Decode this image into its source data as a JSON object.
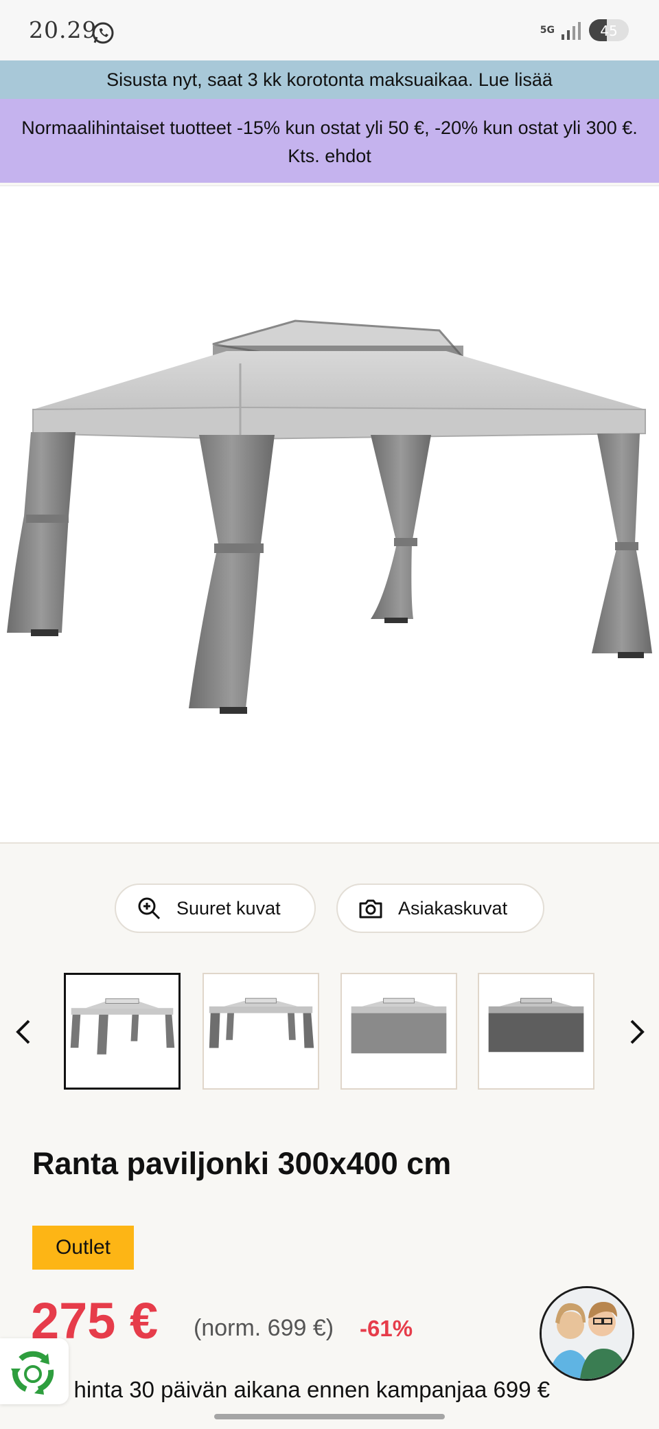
{
  "status_bar": {
    "time": "20.29",
    "network": "5G",
    "battery": "45",
    "battery_level": 0.45
  },
  "banners": {
    "installment": "Sisusta nyt, saat 3 kk korotonta maksuaikaa. Lue lisää",
    "promo": "Normaalihintaiset tuotteet -15% kun ostat yli 50 €, -20% kun ostat yli 300 €. Kts. ehdot"
  },
  "gallery": {
    "large_images_label": "Suuret kuvat",
    "customer_images_label": "Asiakaskuvat",
    "thumbnails": [
      {
        "variant": "open-curtains",
        "active": true
      },
      {
        "variant": "open-curtains",
        "active": false
      },
      {
        "variant": "closed-light",
        "active": false
      },
      {
        "variant": "closed-dark",
        "active": false
      }
    ]
  },
  "product": {
    "title": "Ranta paviljonki 300x400 cm",
    "badge": "Outlet",
    "price": "275 €",
    "normal_price": "(norm. 699 €)",
    "discount": "-61%",
    "lowest_price_note": "n hinta 30 päivän aikana ennen kampanjaa 699 €"
  },
  "colors": {
    "accent_red": "#e63c4a",
    "badge_yellow": "#fdb515",
    "banner_blue": "#a8c8d8",
    "banner_purple": "#c5b3ee"
  },
  "icons": [
    "whatsapp-icon",
    "zoom-in-icon",
    "camera-icon",
    "chevron-left-icon",
    "chevron-right-icon",
    "recycle-icon"
  ]
}
